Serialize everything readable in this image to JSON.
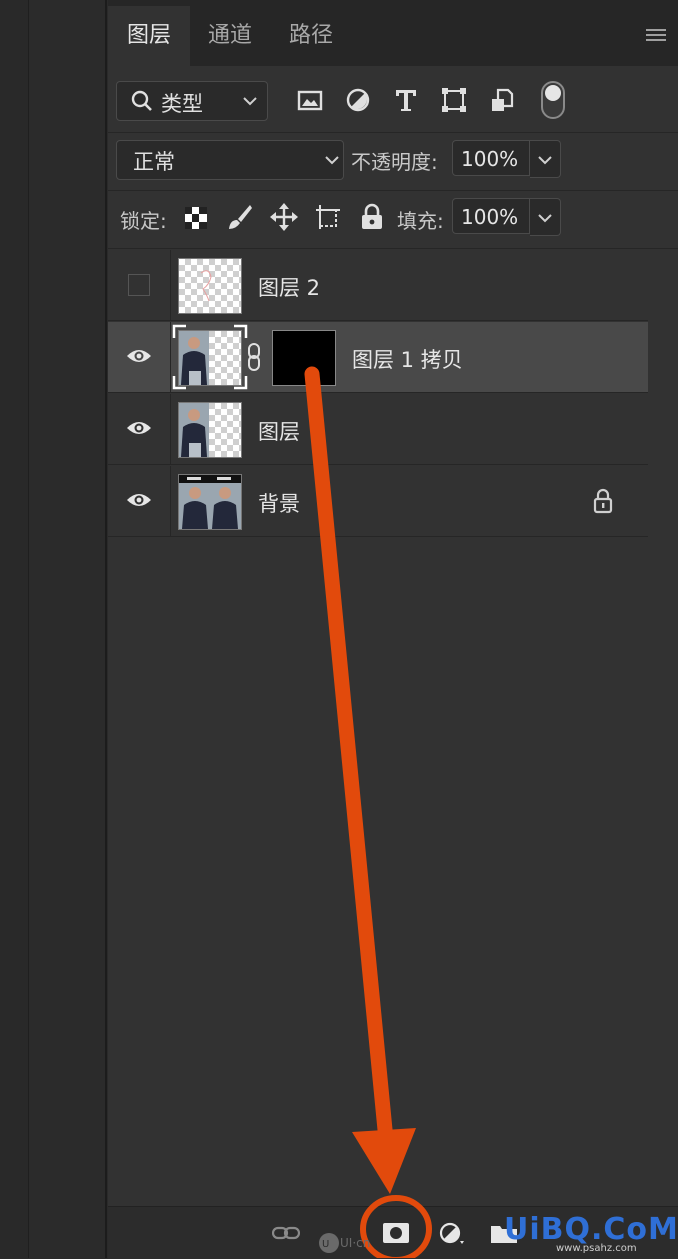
{
  "tabs": [
    {
      "label": "图层",
      "active": true
    },
    {
      "label": "通道",
      "active": false
    },
    {
      "label": "路径",
      "active": false
    }
  ],
  "filter": {
    "label": "类型",
    "icons": [
      "image-filter-icon",
      "adjustment-filter-icon",
      "type-filter-icon",
      "shape-filter-icon",
      "smart-object-filter-icon",
      "filter-toggle-icon"
    ]
  },
  "blend": {
    "mode": "正常",
    "opacity_label": "不透明度:",
    "opacity": "100%"
  },
  "lock": {
    "label": "锁定:",
    "icons": [
      "lock-transparent-icon",
      "lock-image-icon",
      "lock-position-icon",
      "lock-artboard-icon",
      "lock-all-icon"
    ],
    "fill_label": "填充:",
    "fill": "100%"
  },
  "layers": [
    {
      "name": "图层 2",
      "visible": false,
      "selected": false,
      "has_mask": false,
      "locked": false
    },
    {
      "name": "图层 1 拷贝",
      "visible": true,
      "selected": true,
      "has_mask": true,
      "locked": false
    },
    {
      "name": "图层",
      "visible": true,
      "selected": false,
      "has_mask": false,
      "locked": false
    },
    {
      "name": "背景",
      "visible": true,
      "selected": false,
      "has_mask": false,
      "locked": true
    }
  ],
  "bottom_icons": [
    "link-layers-icon",
    "add-mask-icon",
    "adjustment-layer-icon",
    "new-group-icon"
  ],
  "watermark": {
    "ui": "UI·cn",
    "site": "UiBQ.CoM",
    "url": "www.psahz.com"
  },
  "colors": {
    "arrow": "#e24a0c",
    "panel": "#323232",
    "selected_row": "#494949"
  }
}
